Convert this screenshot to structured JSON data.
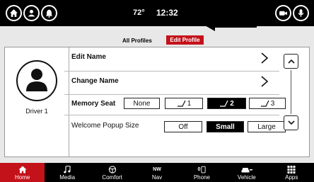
{
  "status": {
    "temperature": "72°",
    "time": "12:32",
    "icons": [
      "home-icon",
      "profile-icon",
      "notification-icon",
      "camera-icon",
      "voice-icon"
    ]
  },
  "tabs": {
    "all_profiles": "All Profiles",
    "edit_profile": "Edit Profile"
  },
  "profile": {
    "driver": "Driver 1"
  },
  "settings": {
    "edit_name": "Edit Name",
    "change_name": "Change Name",
    "memory_seat": {
      "label": "Memory Seat",
      "options": [
        "None",
        "1",
        "2",
        "3"
      ],
      "selected": "2"
    },
    "welcome_popup": {
      "label": "Welcome Popup Size",
      "options": [
        "Off",
        "Small",
        "Large"
      ],
      "selected": "Small"
    }
  },
  "nav": {
    "items": [
      {
        "label": "Home",
        "icon": "home-icon",
        "active": true
      },
      {
        "label": "Media",
        "icon": "music-note-icon",
        "active": false
      },
      {
        "label": "Comfort",
        "icon": "steering-wheel-icon",
        "active": false
      },
      {
        "label": "Nav",
        "icon": "compass-icon",
        "active": false,
        "compass": "NW"
      },
      {
        "label": "Phone",
        "icon": "phone-icon",
        "active": false,
        "badge": "0"
      },
      {
        "label": "Vehicle",
        "icon": "car-icon",
        "active": false
      },
      {
        "label": "Apps",
        "icon": "apps-grid-icon",
        "active": false
      }
    ]
  },
  "colors": {
    "accent": "#c4121b",
    "statusbar": "#000000",
    "navbar": "#000000"
  }
}
